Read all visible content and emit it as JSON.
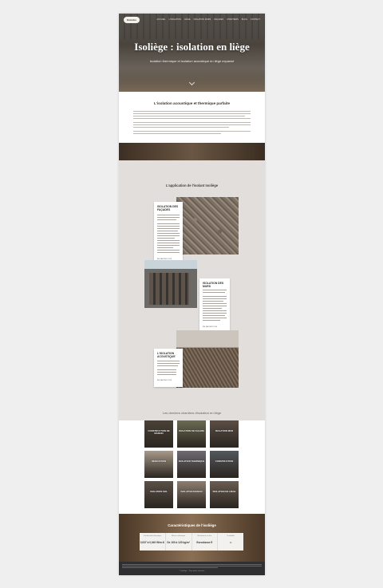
{
  "header": {
    "logo": "Emcobo",
    "nav": [
      "ACCUEIL",
      "L'ISOLATION",
      "LIÈGE",
      "ISOLATION MURS",
      "FAÇADES",
      "CHANTIERS",
      "BLOG",
      "CONTACT"
    ]
  },
  "hero": {
    "title": "Isoliège : isolation en liège",
    "subtitle": "Isolation thermique et isolation acoustique en liège expansé"
  },
  "intro": {
    "title": "L'isolation acoustique et thermique parfaite"
  },
  "application": {
    "title": "L'application de l'isolant Isoliège",
    "cards": [
      {
        "title": "ISOLATION DES FAÇADES",
        "more": "EN SAVOIR PLUS"
      },
      {
        "title": "ISOLATION DES MURS",
        "more": "EN SAVOIR PLUS"
      },
      {
        "title": "L'ISOLATION ACOUSTIQUE",
        "more": "EN SAVOIR PLUS"
      }
    ]
  },
  "chantiers": {
    "title": "Les derniers chantiers d'isolation en liège",
    "tiles": [
      {
        "label": "CONSTRUCTION DE MAISON",
        "color": "#4a4238"
      },
      {
        "label": "ISOLATION DE FAÇADE",
        "color": "#6b6a52"
      },
      {
        "label": "ISOLATION MUR",
        "color": "#5b4e45"
      },
      {
        "label": "RÉNOVATION",
        "color": "#a89a8a"
      },
      {
        "label": "ISOLATION THERMIQUE",
        "color": "#6f6a72"
      },
      {
        "label": "CONSTRUCTION",
        "color": "#54585c"
      },
      {
        "label": "ISOLATION SOL",
        "color": "#5a5047"
      },
      {
        "label": "ISOLATION MAISON",
        "color": "#8e7e70"
      },
      {
        "label": "ISOLATION EN LIÈGE",
        "color": "#6a5d52"
      }
    ]
  },
  "caracteristiques": {
    "title": "Caractéristiques de l'isoliège",
    "stats": [
      {
        "label": "Conductivité thermique",
        "value": "0,037 à 0,040 W/m.K"
      },
      {
        "label": "Masse volumique",
        "value": "De 100 à 120 kg/m³"
      },
      {
        "label": "Résistance au feu",
        "value": "Euroclasse E"
      },
      {
        "label": "Durabilité",
        "value": "∞"
      }
    ]
  },
  "footer": {
    "copy": "© Isoliège – Tous droits réservés"
  }
}
